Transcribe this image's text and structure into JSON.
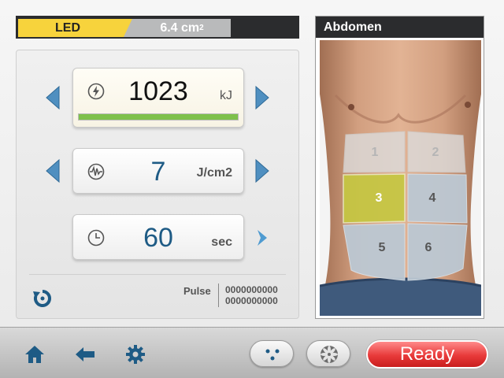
{
  "header": {
    "mode_label": "LED",
    "area_value": "6.4 cm",
    "area_superscript": "2"
  },
  "energy": {
    "value": "1023",
    "unit": "kJ",
    "progress_fraction": 1.0,
    "icon": "lightning-icon"
  },
  "fluence": {
    "value": "7",
    "unit": "J/cm2",
    "icon": "waveform-icon"
  },
  "time": {
    "value": "60",
    "unit": "sec",
    "icon": "clock-icon"
  },
  "pulse": {
    "label": "Pulse",
    "value_line1": "0000000000",
    "value_line2": "0000000000"
  },
  "body_map": {
    "title": "Abdomen",
    "zones": [
      {
        "label": "1",
        "state": "inactive"
      },
      {
        "label": "2",
        "state": "inactive"
      },
      {
        "label": "3",
        "state": "selected"
      },
      {
        "label": "4",
        "state": "available"
      },
      {
        "label": "5",
        "state": "available"
      },
      {
        "label": "6",
        "state": "available"
      }
    ]
  },
  "footer": {
    "ready_label": "Ready"
  },
  "colors": {
    "accent_yellow": "#f7d33c",
    "value_blue": "#1e5b85",
    "progress_green": "#7ec14a",
    "ready_red": "#e83a3a",
    "nav_blue": "#1e5b85"
  }
}
